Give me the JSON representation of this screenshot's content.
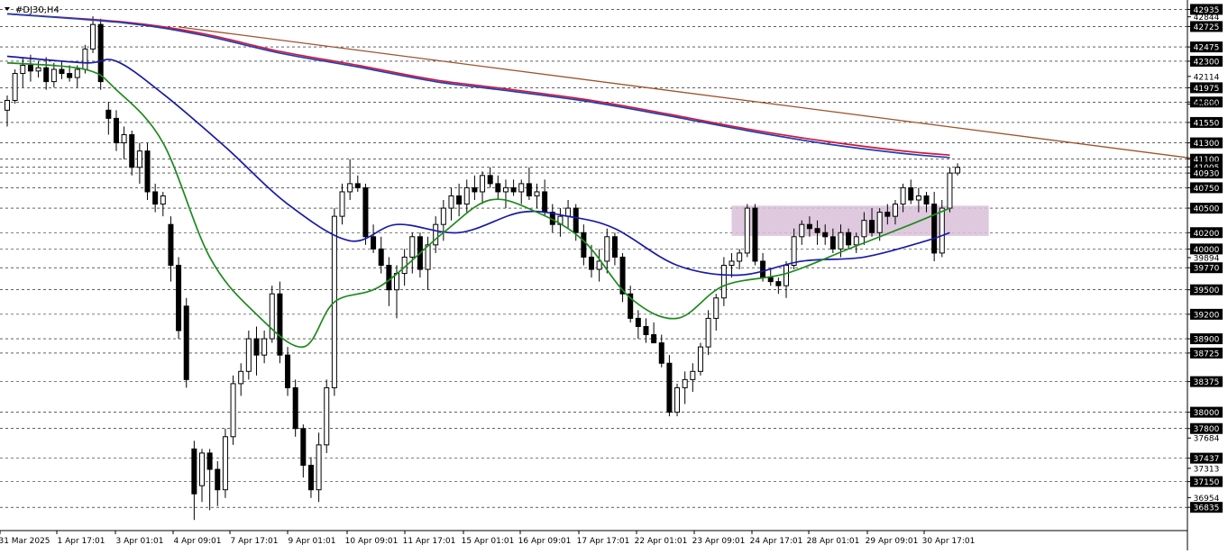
{
  "window": {
    "title": "#DJ30,H4",
    "menu_icon": "triangle-down-icon"
  },
  "colors": {
    "background": "#ffffff",
    "grid": "#000000",
    "candle": "#000000",
    "price_tag_bg": "#000000",
    "price_tag_text": "#ffffff",
    "ma_red": "#d4143c",
    "ma_blue_slow": "#1f3fb0",
    "ma_blue_fast": "#1a1aa8",
    "ma_green": "#1e8a1e",
    "trendline": "#a0522d",
    "zone": "#d8bfd8"
  },
  "chart_data": {
    "type": "candlestick",
    "symbol": "#DJ30",
    "timeframe": "H4",
    "ylim": [
      36550,
      43050
    ],
    "grid": "dashed-horizontal",
    "x_tick_labels": [
      "31 Mar 2025",
      "1 Apr 17:01",
      "3 Apr 01:01",
      "4 Apr 09:01",
      "7 Apr 17:01",
      "9 Apr 01:01",
      "10 Apr 09:01",
      "11 Apr 17:01",
      "15 Apr 01:01",
      "16 Apr 09:01",
      "17 Apr 17:01",
      "22 Apr 01:01",
      "23 Apr 09:01",
      "24 Apr 17:01",
      "28 Apr 01:01",
      "29 Apr 09:01",
      "30 Apr 17:01"
    ],
    "y_tag_levels": [
      42935,
      42725,
      42475,
      42300,
      41975,
      41800,
      41550,
      41300,
      41100,
      41005,
      40930,
      40750,
      40500,
      40200,
      40000,
      39770,
      39500,
      39200,
      38900,
      38725,
      38375,
      38000,
      37800,
      37437,
      37150,
      36835
    ],
    "y_plain_labels": [
      42844,
      42114,
      41774,
      39894,
      37684,
      37313,
      36954
    ],
    "candles": [
      [
        41700,
        41880,
        41500,
        41820
      ],
      [
        41820,
        42200,
        41780,
        42150
      ],
      [
        42150,
        42350,
        41980,
        42250
      ],
      [
        42250,
        42380,
        42050,
        42180
      ],
      [
        42180,
        42300,
        42100,
        42220
      ],
      [
        42220,
        42350,
        41950,
        42050
      ],
      [
        42050,
        42280,
        41980,
        42200
      ],
      [
        42200,
        42300,
        42080,
        42150
      ],
      [
        42150,
        42250,
        42050,
        42100
      ],
      [
        42100,
        42250,
        41980,
        42200
      ],
      [
        42200,
        42500,
        42150,
        42450
      ],
      [
        42450,
        42850,
        42400,
        42750
      ],
      [
        42750,
        42820,
        41950,
        42050
      ],
      [
        41700,
        41800,
        41400,
        41600
      ],
      [
        41600,
        41700,
        41200,
        41300
      ],
      [
        41300,
        41500,
        41100,
        41400
      ],
      [
        41400,
        41450,
        40900,
        41000
      ],
      [
        41000,
        41300,
        40800,
        41200
      ],
      [
        41200,
        41300,
        40600,
        40700
      ],
      [
        40700,
        40800,
        40450,
        40550
      ],
      [
        40550,
        40700,
        40400,
        40650
      ],
      [
        40300,
        40400,
        39600,
        39800
      ],
      [
        39800,
        39900,
        38900,
        39000
      ],
      [
        39300,
        39400,
        38300,
        38400
      ],
      [
        37550,
        37650,
        36680,
        37000
      ],
      [
        37100,
        37550,
        36900,
        37500
      ],
      [
        37500,
        37550,
        36800,
        37300
      ],
      [
        37300,
        37400,
        36850,
        37050
      ],
      [
        37050,
        37800,
        36950,
        37700
      ],
      [
        37700,
        38450,
        37600,
        38350
      ],
      [
        38350,
        38600,
        38200,
        38500
      ],
      [
        38500,
        39000,
        38400,
        38900
      ],
      [
        38900,
        39050,
        38450,
        38700
      ],
      [
        38700,
        39000,
        38600,
        38900
      ],
      [
        38900,
        39550,
        38850,
        39450
      ],
      [
        39450,
        39600,
        38600,
        38700
      ],
      [
        38700,
        38800,
        38200,
        38300
      ],
      [
        38300,
        38400,
        37700,
        37800
      ],
      [
        37800,
        37850,
        37200,
        37350
      ],
      [
        37350,
        37450,
        36950,
        37050
      ],
      [
        37050,
        37750,
        36900,
        37600
      ],
      [
        37600,
        38400,
        37500,
        38300
      ],
      [
        38300,
        40500,
        38200,
        40400
      ],
      [
        40400,
        40800,
        40300,
        40700
      ],
      [
        40700,
        41100,
        40600,
        40800
      ],
      [
        40800,
        40900,
        40700,
        40750
      ],
      [
        40750,
        40800,
        40050,
        40150
      ],
      [
        40150,
        40300,
        39950,
        40000
      ],
      [
        40000,
        40150,
        39700,
        39800
      ],
      [
        39800,
        39900,
        39300,
        39500
      ],
      [
        39500,
        39800,
        39150,
        39700
      ],
      [
        39700,
        40000,
        39550,
        39900
      ],
      [
        39900,
        40200,
        39700,
        40150
      ],
      [
        40150,
        40200,
        39650,
        39750
      ],
      [
        39750,
        40150,
        39500,
        40050
      ],
      [
        40050,
        40400,
        39950,
        40300
      ],
      [
        40300,
        40600,
        40100,
        40500
      ],
      [
        40500,
        40750,
        40350,
        40650
      ],
      [
        40650,
        40800,
        40400,
        40550
      ],
      [
        40550,
        40850,
        40450,
        40750
      ],
      [
        40750,
        40900,
        40600,
        40700
      ],
      [
        40700,
        40950,
        40550,
        40900
      ],
      [
        40900,
        41000,
        40750,
        40800
      ],
      [
        40800,
        40900,
        40600,
        40700
      ],
      [
        40700,
        40850,
        40500,
        40750
      ],
      [
        40750,
        40850,
        40650,
        40700
      ],
      [
        40700,
        40850,
        40550,
        40800
      ],
      [
        40800,
        41000,
        40600,
        40650
      ],
      [
        40650,
        40800,
        40500,
        40700
      ],
      [
        40700,
        40850,
        40400,
        40450
      ],
      [
        40450,
        40550,
        40200,
        40300
      ],
      [
        40300,
        40500,
        40150,
        40400
      ],
      [
        40400,
        40600,
        40250,
        40500
      ],
      [
        40500,
        40550,
        40100,
        40200
      ],
      [
        40200,
        40300,
        39800,
        39900
      ],
      [
        39900,
        40050,
        39650,
        39750
      ],
      [
        39750,
        40000,
        39600,
        39850
      ],
      [
        39850,
        40250,
        39700,
        40150
      ],
      [
        40150,
        40200,
        39800,
        39900
      ],
      [
        39900,
        39950,
        39350,
        39450
      ],
      [
        39450,
        39550,
        39100,
        39150
      ],
      [
        39150,
        39250,
        38900,
        39050
      ],
      [
        39050,
        39150,
        38850,
        38950
      ],
      [
        38950,
        39100,
        38850,
        38850
      ],
      [
        38850,
        38950,
        38550,
        38600
      ],
      [
        38600,
        38700,
        37950,
        38000
      ],
      [
        38000,
        38350,
        37950,
        38300
      ],
      [
        38300,
        38500,
        38100,
        38400
      ],
      [
        38400,
        38600,
        38250,
        38500
      ],
      [
        38500,
        38850,
        38450,
        38800
      ],
      [
        38800,
        39250,
        38700,
        39150
      ],
      [
        39150,
        39450,
        39000,
        39400
      ],
      [
        39400,
        39900,
        39300,
        39800
      ],
      [
        39800,
        39950,
        39650,
        39850
      ],
      [
        39850,
        40000,
        39750,
        39950
      ],
      [
        39950,
        40550,
        39900,
        40500
      ],
      [
        40500,
        40550,
        39800,
        39850
      ],
      [
        39850,
        39950,
        39600,
        39650
      ],
      [
        39650,
        39750,
        39550,
        39600
      ],
      [
        39600,
        39650,
        39450,
        39550
      ],
      [
        39550,
        39850,
        39400,
        39800
      ],
      [
        39800,
        40250,
        39750,
        40150
      ],
      [
        40150,
        40350,
        40050,
        40300
      ],
      [
        40300,
        40400,
        40150,
        40250
      ],
      [
        40250,
        40350,
        40050,
        40200
      ],
      [
        40200,
        40300,
        40050,
        40150
      ],
      [
        40150,
        40250,
        39950,
        40000
      ],
      [
        40000,
        40300,
        39900,
        40200
      ],
      [
        40200,
        40250,
        40000,
        40050
      ],
      [
        40050,
        40200,
        39950,
        40150
      ],
      [
        40150,
        40450,
        40050,
        40350
      ],
      [
        40350,
        40500,
        40150,
        40200
      ],
      [
        40200,
        40500,
        40100,
        40450
      ],
      [
        40450,
        40550,
        40300,
        40400
      ],
      [
        40400,
        40600,
        40300,
        40550
      ],
      [
        40550,
        40800,
        40450,
        40750
      ],
      [
        40750,
        40850,
        40550,
        40600
      ],
      [
        40600,
        40750,
        40450,
        40650
      ],
      [
        40650,
        40700,
        40450,
        40550
      ],
      [
        40550,
        40700,
        39850,
        39950
      ],
      [
        39950,
        40600,
        39900,
        40500
      ],
      [
        40500,
        41000,
        40450,
        40930
      ],
      [
        40930,
        41050,
        40900,
        41000
      ]
    ],
    "series": [
      {
        "name": "",
        "color": "#d4143c",
        "points": [
          [
            0,
            42880
          ],
          [
            15,
            42780
          ],
          [
            25,
            42640
          ],
          [
            35,
            42420
          ],
          [
            45,
            42250
          ],
          [
            55,
            42070
          ],
          [
            65,
            41950
          ],
          [
            75,
            41820
          ],
          [
            85,
            41650
          ],
          [
            95,
            41470
          ],
          [
            105,
            41320
          ],
          [
            115,
            41200
          ],
          [
            121,
            41150
          ]
        ]
      },
      {
        "name": "",
        "color": "#1f3fb0",
        "points": [
          [
            0,
            42880
          ],
          [
            15,
            42770
          ],
          [
            25,
            42620
          ],
          [
            35,
            42400
          ],
          [
            45,
            42230
          ],
          [
            55,
            42050
          ],
          [
            65,
            41930
          ],
          [
            75,
            41800
          ],
          [
            85,
            41630
          ],
          [
            95,
            41450
          ],
          [
            105,
            41290
          ],
          [
            115,
            41170
          ],
          [
            121,
            41120
          ]
        ]
      },
      {
        "name": "",
        "color": "#1a1aa8",
        "points": [
          [
            0,
            42360
          ],
          [
            10,
            42280
          ],
          [
            14,
            42300
          ],
          [
            20,
            41900
          ],
          [
            28,
            41250
          ],
          [
            36,
            40550
          ],
          [
            44,
            40100
          ],
          [
            50,
            40300
          ],
          [
            58,
            40200
          ],
          [
            66,
            40450
          ],
          [
            72,
            40400
          ],
          [
            78,
            40250
          ],
          [
            86,
            39800
          ],
          [
            94,
            39680
          ],
          [
            102,
            39850
          ],
          [
            110,
            39900
          ],
          [
            118,
            40100
          ],
          [
            121,
            40200
          ]
        ]
      },
      {
        "name": "",
        "color": "#1e8a1e",
        "points": [
          [
            0,
            42280
          ],
          [
            10,
            42200
          ],
          [
            14,
            41950
          ],
          [
            20,
            41300
          ],
          [
            26,
            39900
          ],
          [
            32,
            39200
          ],
          [
            38,
            38800
          ],
          [
            42,
            39350
          ],
          [
            48,
            39550
          ],
          [
            56,
            40200
          ],
          [
            62,
            40600
          ],
          [
            68,
            40450
          ],
          [
            74,
            40100
          ],
          [
            80,
            39400
          ],
          [
            86,
            39150
          ],
          [
            92,
            39550
          ],
          [
            100,
            39700
          ],
          [
            108,
            40000
          ],
          [
            116,
            40300
          ],
          [
            121,
            40500
          ]
        ]
      }
    ],
    "trendline": {
      "from": [
        22,
        42720
      ],
      "to": [
        153,
        41100
      ]
    },
    "zone": {
      "from": [
        93,
        40530
      ],
      "to": [
        126,
        40160
      ]
    }
  }
}
